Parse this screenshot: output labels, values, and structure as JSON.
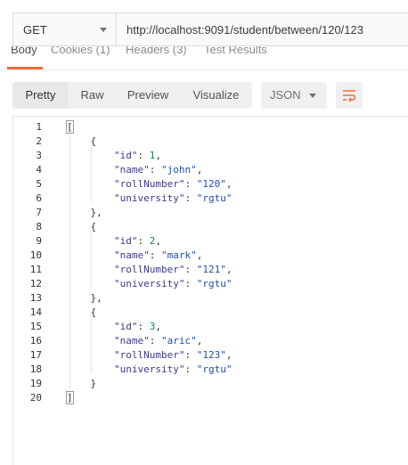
{
  "request": {
    "method": "GET",
    "url": "http://localhost:9091/student/between/120/123"
  },
  "response_tabs": [
    {
      "label": "Body",
      "active": true
    },
    {
      "label": "Cookies (1)",
      "active": false
    },
    {
      "label": "Headers (3)",
      "active": false
    },
    {
      "label": "Test Results",
      "active": false
    }
  ],
  "view_modes": [
    {
      "label": "Pretty",
      "active": true
    },
    {
      "label": "Raw",
      "active": false
    },
    {
      "label": "Preview",
      "active": false
    },
    {
      "label": "Visualize",
      "active": false
    }
  ],
  "format": {
    "selected": "JSON"
  },
  "icons": {
    "method_caret": "chevron-down-icon",
    "format_caret": "chevron-down-icon",
    "wrap": "wrap-lines-icon"
  },
  "colors": {
    "accent": "#f26b3a",
    "json_key": "#3a3a8c",
    "json_string": "#1d4fa8",
    "json_number": "#098658"
  },
  "response_body": {
    "line_numbers": [
      "1",
      "2",
      "3",
      "4",
      "5",
      "6",
      "7",
      "8",
      "9",
      "10",
      "11",
      "12",
      "13",
      "14",
      "15",
      "16",
      "17",
      "18",
      "19",
      "20"
    ],
    "lines": [
      "[",
      "    {",
      "        \"id\": 1,",
      "        \"name\": \"john\",",
      "        \"rollNumber\": \"120\",",
      "        \"university\": \"rgtu\"",
      "    },",
      "    {",
      "        \"id\": 2,",
      "        \"name\": \"mark\",",
      "        \"rollNumber\": \"121\",",
      "        \"university\": \"rgtu\"",
      "    },",
      "    {",
      "        \"id\": 3,",
      "        \"name\": \"aric\",",
      "        \"rollNumber\": \"123\",",
      "        \"university\": \"rgtu\"",
      "    }",
      "]"
    ]
  }
}
